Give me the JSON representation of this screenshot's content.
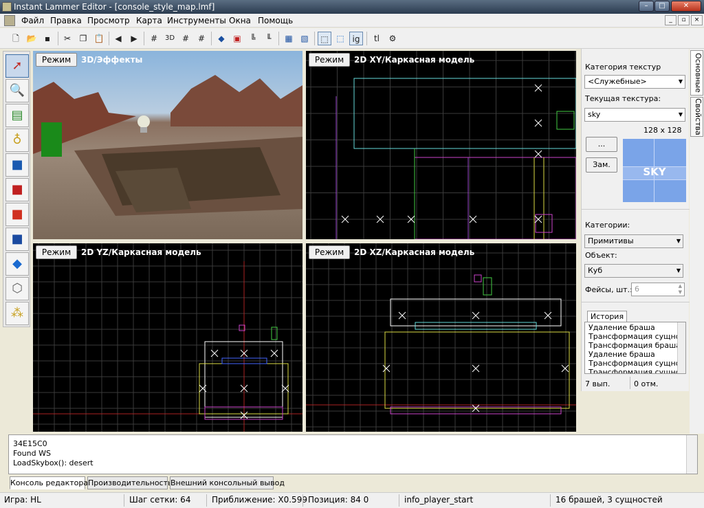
{
  "window": {
    "title": "Instant Lammer Editor - [console_style_map.lmf]"
  },
  "menu": [
    "Файл",
    "Правка",
    "Просмотр",
    "Карта",
    "Инструменты",
    "Окна",
    "Помощь"
  ],
  "toolbar": {
    "icons": [
      "new-icon",
      "open-icon",
      "save-icon",
      "cut-icon",
      "copy-icon",
      "paste-icon",
      "undo-icon",
      "redo-icon",
      "grid-icon",
      "3d-grid-icon",
      "grid-snap-icon",
      "grid-dots-icon",
      "texture-lock-icon",
      "select-box-icon",
      "align-icon",
      "align-left-icon",
      "group-icon",
      "ungroup-icon",
      "bbox-icon",
      "select-icon"
    ],
    "text_buttons": {
      "ig": "ig",
      "tl": "tl"
    }
  },
  "tools": [
    "pointer-tool",
    "magnifier-tool",
    "camera-tool",
    "light-entity-tool",
    "block-tool",
    "texture-tool",
    "apply-texture-tool",
    "decal-tool",
    "clip-tool",
    "vertex-tool",
    "path-tool"
  ],
  "viewports": {
    "mode_label": "Режим",
    "persp_title": "3D/Эффекты",
    "xy_title": "2D XY/Каркасная модель",
    "yz_title": "2D YZ/Каркасная модель",
    "xz_title": "2D XZ/Каркасная модель"
  },
  "right_panel": {
    "texture_category_label": "Категория текстур",
    "texture_category_value": "<Служебные>",
    "current_texture_label": "Текущая текстура:",
    "current_texture_value": "sky",
    "texture_size": "128 x 128",
    "browse_button": "...",
    "replace_button": "Зам.",
    "sky_text": "SKY",
    "categories_label": "Категории:",
    "categories_value": "Примитивы",
    "object_label": "Объект:",
    "object_value": "Куб",
    "faces_label": "Фейсы, шт.:",
    "faces_value": "6",
    "history_tab": "История",
    "history_items": [
      "Удаление браша",
      "Трансформация сущности",
      "Трансформация браша",
      "Удаление браша",
      "Трансформация сущности",
      "Трансформация сущности"
    ],
    "done_count": "7 вып.",
    "undone_count": "0 отм."
  },
  "side_tabs": [
    "Основные",
    "Свойства"
  ],
  "console": {
    "lines": [
      "34E15C0",
      "Found WS",
      "LoadSkybox(): desert"
    ],
    "tabs": [
      "Консоль редактора",
      "Производительность",
      "Внешний консольный вывод"
    ]
  },
  "status": {
    "game": "Игра: HL",
    "grid": "Шаг сетки: 64",
    "zoom": "Приближение: X0.599",
    "position": "Позиция: 84 0",
    "entity": "info_player_start",
    "counts": "16 брашей, 3 сущностей"
  }
}
